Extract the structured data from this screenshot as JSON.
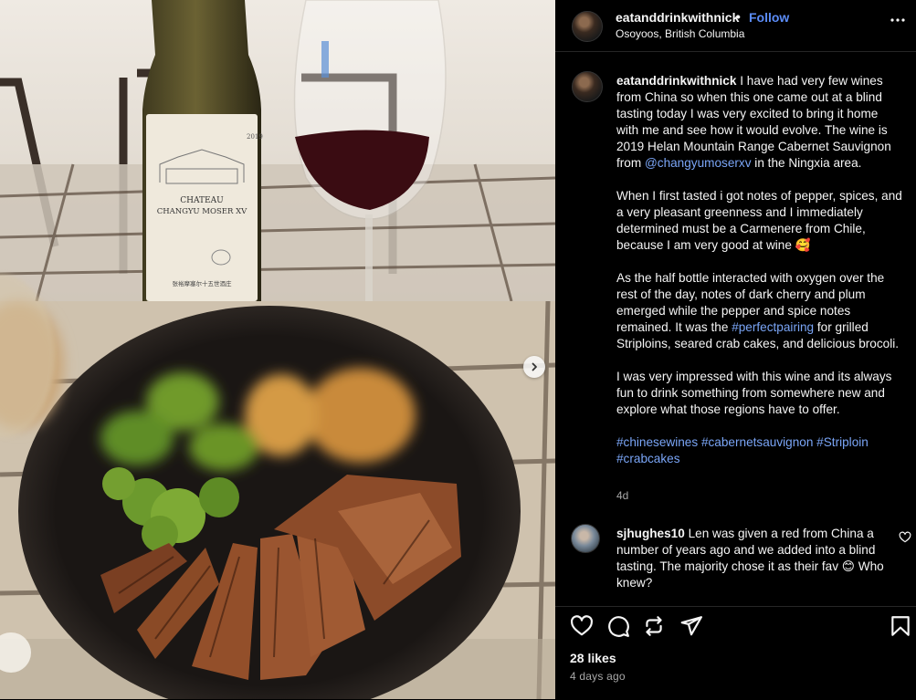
{
  "post": {
    "username": "eatanddrinkwithnick",
    "follow_label": "Follow",
    "separator": "•",
    "location": "Osoyoos, British Columbia",
    "icons": {
      "more": "more-horizontal-icon",
      "next": "chevron-right-icon"
    }
  },
  "photo": {
    "label_line1": "CHATEAU",
    "label_line2": "CHANGYU MOSER XV",
    "vintage": "2019",
    "cn_label": "张裕摩塞尔十五世酒庄"
  },
  "caption": {
    "username": "eatanddrinkwithnick",
    "p1_a": " I have had very few wines from China so when this one came out at a blind tasting today I was very excited to bring it home with me and see how it would evolve. The wine is 2019 Helan Mountain Range Cabernet Sauvignon from ",
    "p1_mention": "@changyumoserxv",
    "p1_b": " in the Ningxia area.",
    "p2": "When I first tasted i got notes of pepper, spices, and a very pleasant greenness and I immediately determined must be a Carmenere from Chile, because I am very good at wine 🥰",
    "p3_a": "As the half bottle interacted with oxygen over the rest of the day, notes of dark cherry and plum emerged while the pepper and spice notes remained. It was the ",
    "p3_tag": "#perfectpairing",
    "p3_b": " for grilled Striploins, seared crab cakes, and delicious brocoli.",
    "p4": "I was very impressed with this wine and its always fun to drink something from somewhere new and explore what those regions have to offer.",
    "tags": [
      "#chinesewines",
      "#cabernetsauvignon",
      "#Striploin",
      "#crabcakes"
    ],
    "time": "4d"
  },
  "comment": {
    "username": "sjhughes10",
    "text": " Len was given a red from China a number of years ago and we added into a blind tasting. The majority chose it as their fav 😊 Who knew?"
  },
  "footer": {
    "likes": "28 likes",
    "posted": "4 days ago",
    "icons": [
      "heart-icon",
      "comment-icon",
      "repost-icon",
      "share-icon",
      "bookmark-icon"
    ]
  },
  "colors": {
    "accent": "#5b8cf7",
    "link": "#7aa5f6",
    "muted": "#a8a8a8",
    "background": "#000000"
  }
}
